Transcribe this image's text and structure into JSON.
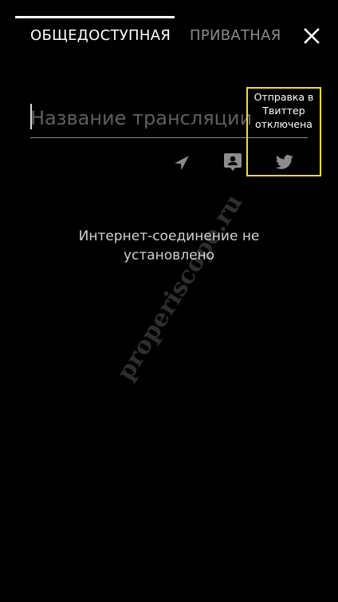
{
  "tabs": {
    "public_label": "ОБЩЕДОСТУПНАЯ",
    "private_label": "ПРИВАТНАЯ",
    "active": "public"
  },
  "close_icon": "close-icon",
  "broadcast_title": {
    "placeholder": "Название трансляции",
    "value": ""
  },
  "actions": [
    {
      "icon": "location-arrow-icon",
      "state": "inactive"
    },
    {
      "icon": "chat-icon",
      "state": "inactive"
    },
    {
      "icon": "twitter-icon",
      "state": "inactive"
    }
  ],
  "tooltip": {
    "text": "Отправка в Твиттер отключена",
    "border_color": "#f2dd2c"
  },
  "status": {
    "message": "Интернет-соединение не установлено"
  },
  "watermark": {
    "text": "properiscope.ru"
  },
  "colors": {
    "background": "#000000",
    "text_active": "#ffffff",
    "text_inactive": "#8a8a8a",
    "icon": "#8c8c8c"
  }
}
